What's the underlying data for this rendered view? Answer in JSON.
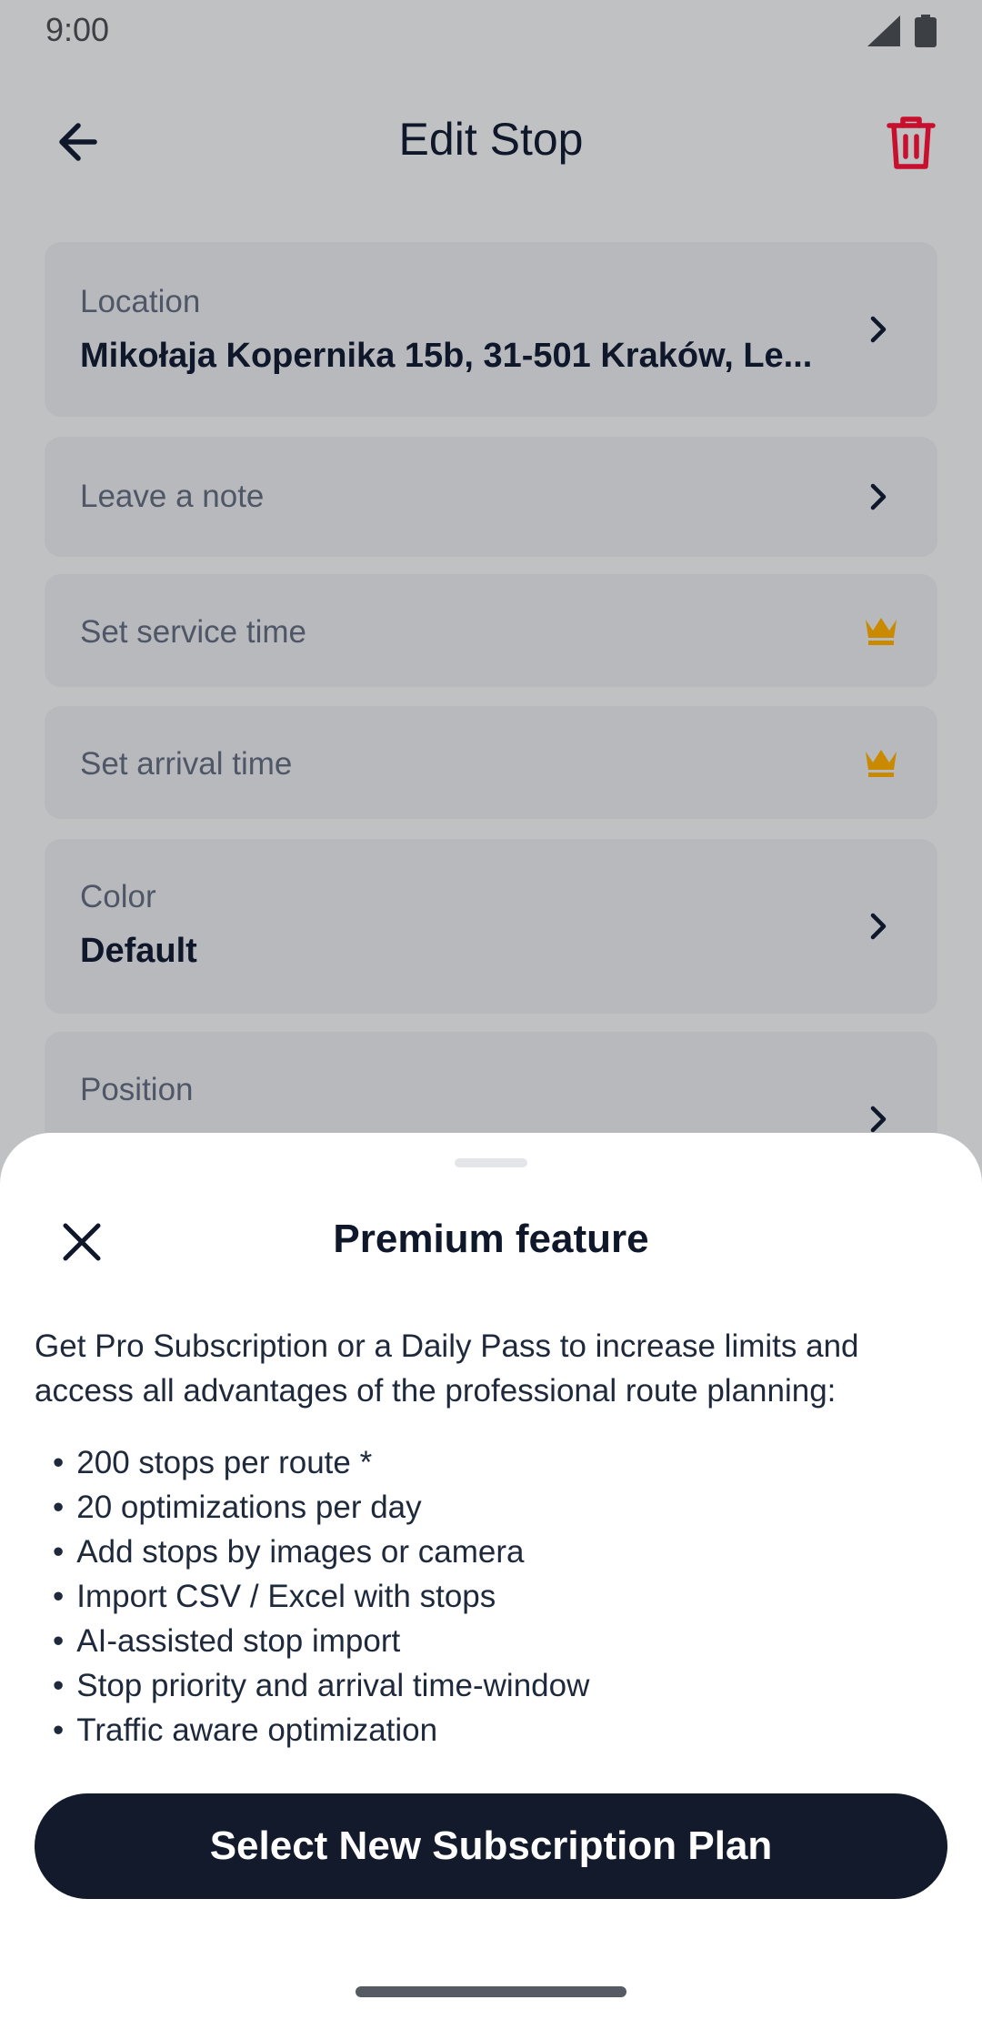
{
  "status_bar": {
    "time": "9:00",
    "signal_icon": "signal-icon",
    "battery_icon": "battery-icon"
  },
  "app_bar": {
    "title": "Edit Stop",
    "back_icon": "arrow-left-icon",
    "delete_icon": "trash-icon",
    "delete_color": "#c8102e"
  },
  "cards": {
    "location": {
      "label": "Location",
      "value": "Mikołaja Kopernika 15b, 31-501 Kraków, Le..."
    },
    "note": {
      "label": "Leave a note"
    },
    "service_time": {
      "label": "Set service time",
      "icon": "crown-icon"
    },
    "arrival_time": {
      "label": "Set arrival time",
      "icon": "crown-icon"
    },
    "color": {
      "label": "Color",
      "value": "Default"
    },
    "position": {
      "label": "Position"
    }
  },
  "colors": {
    "crown": "#c98a00",
    "cta_bg": "#121a2b",
    "overlay_bg": "#c0c1c3"
  },
  "sheet": {
    "title": "Premium feature",
    "description": "Get Pro Subscription or a Daily Pass to increase limits and access all advantages of the professional route planning:",
    "features": [
      "200 stops per route *",
      "20 optimizations per day",
      "Add stops by images or camera",
      "Import CSV / Excel with stops",
      "AI-assisted stop import",
      "Stop priority and arrival time-window",
      "Traffic aware optimization"
    ],
    "cta_label": "Select New Subscription Plan"
  }
}
